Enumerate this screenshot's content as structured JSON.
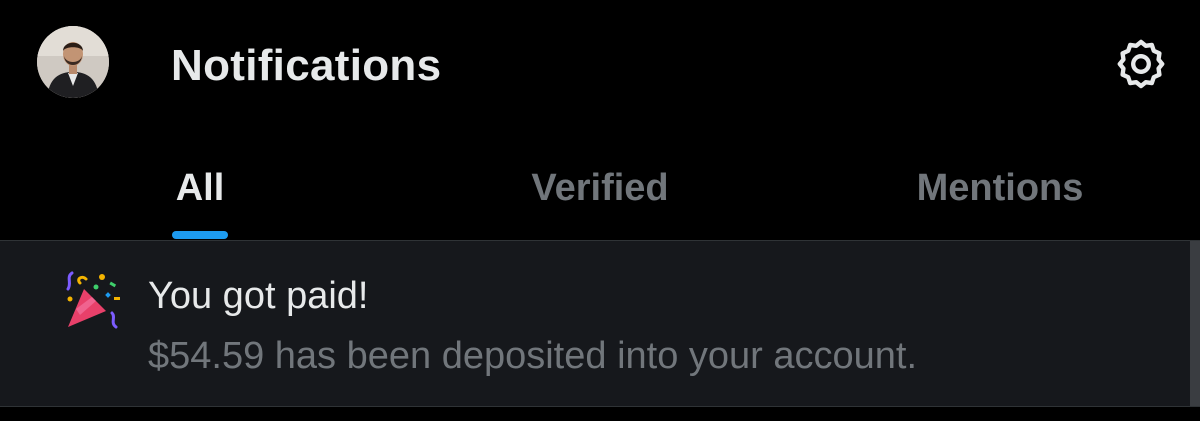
{
  "header": {
    "title": "Notifications",
    "avatar_icon": "user-avatar",
    "settings_icon": "gear-icon"
  },
  "tabs": [
    {
      "label": "All",
      "active": true
    },
    {
      "label": "Verified",
      "active": false
    },
    {
      "label": "Mentions",
      "active": false
    }
  ],
  "notification": {
    "icon": "party-popper-icon",
    "title": "You got paid!",
    "body": "$54.59 has been deposited into your account."
  },
  "colors": {
    "background": "#000000",
    "text_primary": "#e7e9ea",
    "text_secondary": "#71767b",
    "accent": "#1d9bf0",
    "highlight_row": "#16181c"
  }
}
